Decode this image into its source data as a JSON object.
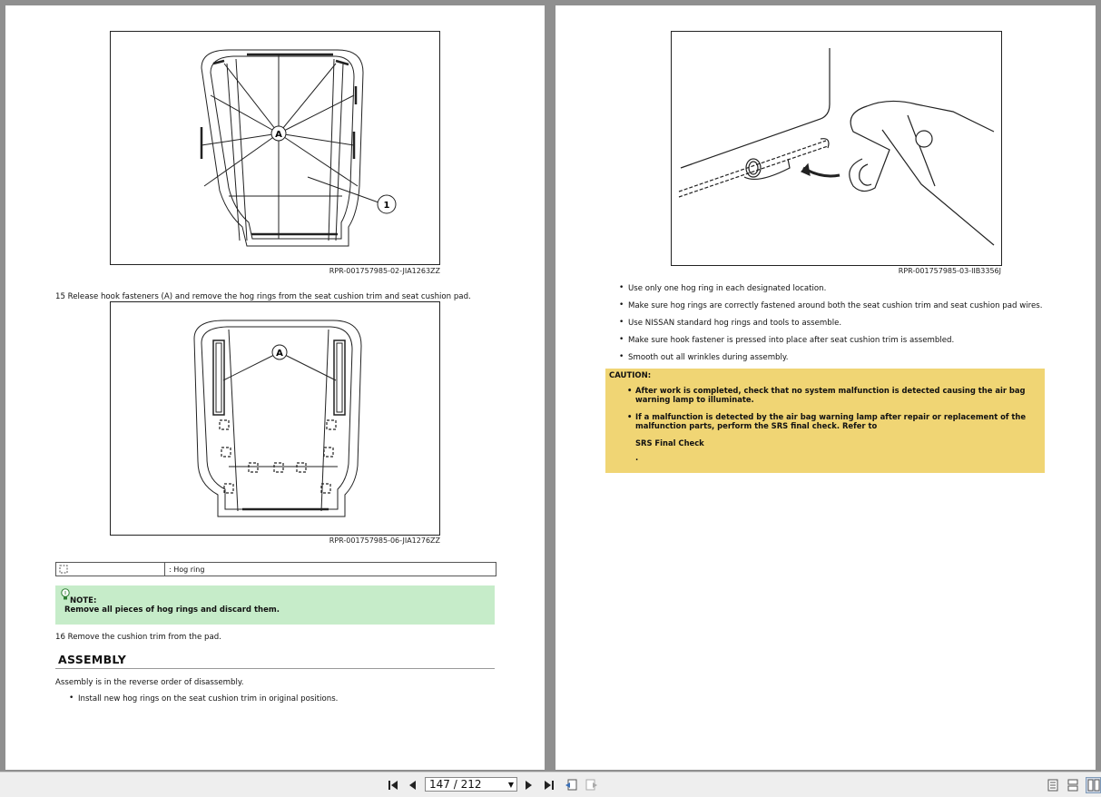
{
  "left_page": {
    "figure1_caption": "RPR-001757985-02-JIA1263ZZ",
    "figure1_labels": {
      "a": "A",
      "one": "1"
    },
    "step15": "15 Release hook fasteners (A) and remove the hog rings from the seat cushion trim and seat cushion pad.",
    "figure2_caption": "RPR-001757985-06-JIA1276ZZ",
    "figure2_labels": {
      "a": "A"
    },
    "legend": {
      "symbol_icon": "hog-ring-symbol-icon",
      "description": ": Hog ring"
    },
    "note": {
      "title": "NOTE:",
      "body": "Remove all pieces of hog rings and discard them."
    },
    "step16": "16 Remove the cushion trim from the pad.",
    "section_title": "ASSEMBLY",
    "assembly_intro": "Assembly is in the reverse order of disassembly.",
    "assembly_bullets": [
      "Install new hog rings on the seat cushion trim in original positions."
    ]
  },
  "right_page": {
    "figure3_caption": "RPR-001757985-03-IIB3356J",
    "bullets": [
      "Use only one hog ring in each designated location.",
      "Make sure hog rings are correctly fastened around both the seat cushion trim and seat cushion pad wires.",
      "Use NISSAN standard hog rings and tools to assemble.",
      "Make sure hook fastener is pressed into place after seat cushion trim is assembled.",
      "Smooth out all wrinkles during assembly."
    ],
    "caution": {
      "title": "CAUTION:",
      "items": [
        "After work is completed, check that no system malfunction is detected causing the air bag warning lamp to illuminate.",
        "If a malfunction is detected by the air bag warning lamp after repair or replacement of the malfunction parts, perform the SRS final check. Refer to"
      ],
      "reference": "SRS Final Check",
      "trailing": "."
    }
  },
  "toolbar": {
    "page_indicator": "147 / 212",
    "colors": {
      "caution_bg": "#f0d574",
      "note_bg": "#c6ecc9"
    }
  }
}
